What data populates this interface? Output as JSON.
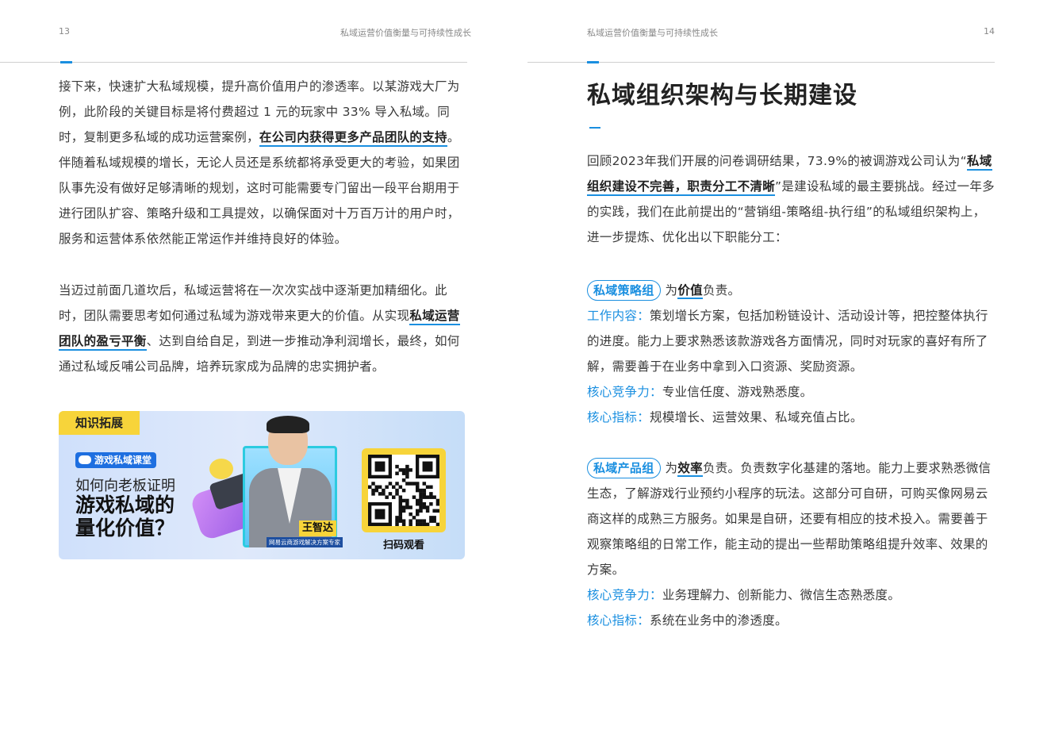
{
  "left_page": {
    "page_number": "13",
    "header_title": "私域运营价值衡量与可持续性成长",
    "para1": [
      {
        "t": "接下来，快速扩大私域规模，提升高价值用户的渗透率。以某游戏大厂为例，此阶段的关键目标是将付费超过 1 元的玩家中 33% 导入私域。同时，复制更多私域的成功运营案例，"
      },
      {
        "t": "在公司内获得更多产品团队的支持",
        "b": true
      },
      {
        "t": "。伴随着私域规模的增长，无论人员还是系统都将承受更大的考验，如果团队事先没有做好足够清晰的规划，这时可能需要专门留出一段平台期用于进行团队扩容、策略升级和工具提效，以确保面对十万百万计的用户时，服务和运营体系依然能正常运作并维持良好的体验。"
      }
    ],
    "para2": [
      {
        "t": "当迈过前面几道坎后，私域运营将在一次次实战中逐渐更加精细化。此时，团队需要思考如何通过私域为游戏带来更大的价值。从实现"
      },
      {
        "t": "私域运营团队的盈亏平衡",
        "b": true
      },
      {
        "t": "、达到自给自足，到进一步推动净利润增长，最终，如何通过私域反哺公司品牌，培养玩家成为品牌的忠实拥护者。"
      }
    ],
    "banner": {
      "tag": "知识拓展",
      "course": "游戏私域课堂",
      "subtitle": "如何向老板证明",
      "headline1": "游戏私域的",
      "headline2": "量化价值？",
      "speaker_name": "王智达",
      "speaker_title": "网易云商游戏解决方案专家",
      "qr_label": "扫码观看"
    }
  },
  "right_page": {
    "page_number": "14",
    "header_title": "私域运营价值衡量与可持续性成长",
    "title": "私域组织架构与长期建设",
    "intro": [
      {
        "t": "回顾2023年我们开展的问卷调研结果，73.9%的被调游戏公司认为“"
      },
      {
        "t": "私域组织建设不完善，职责分工不清晰",
        "b": true
      },
      {
        "t": "”是建设私域的最主要挑战。经过一年多的实践，我们在此前提出的“营销组-策略组-执行组”的私域组织架构上，进一步提炼、优化出以下职能分工："
      }
    ],
    "strategy": {
      "pill": "私域策略组",
      "lead_pre": "为",
      "lead_bold": "价值",
      "lead_post": "负责。",
      "work_label": "工作内容：",
      "work_text": "策划增长方案，包括加粉链设计、活动设计等，把控整体执行的进度。能力上要求熟悉该款游戏各方面情况，同时对玩家的喜好有所了解，需要善于在业务中拿到入口资源、奖励资源。",
      "comp_label": "核心竞争力：",
      "comp_text": "专业信任度、游戏熟悉度。",
      "kpi_label": "核心指标：",
      "kpi_text": "规模增长、运营效果、私域充值占比。"
    },
    "product": {
      "pill": "私域产品组",
      "lead_pre": "为",
      "lead_bold": "效率",
      "lead_post": "负责。负责数字化基建的落地。能力上要求熟悉微信生态，了解游戏行业预约小程序的玩法。这部分可自研，可购买像网易云商这样的成熟三方服务。如果是自研，还要有相应的技术投入。需要善于观察策略组的日常工作，能主动的提出一些帮助策略组提升效率、效果的方案。",
      "comp_label": "核心竞争力：",
      "comp_text": "业务理解力、创新能力、微信生态熟悉度。",
      "kpi_label": "核心指标：",
      "kpi_text": "系统在业务中的渗透度。"
    }
  },
  "colors": {
    "accent": "#1a8fe0",
    "banner_yellow": "#f7d43a",
    "course_blue": "#1e6fe0"
  }
}
